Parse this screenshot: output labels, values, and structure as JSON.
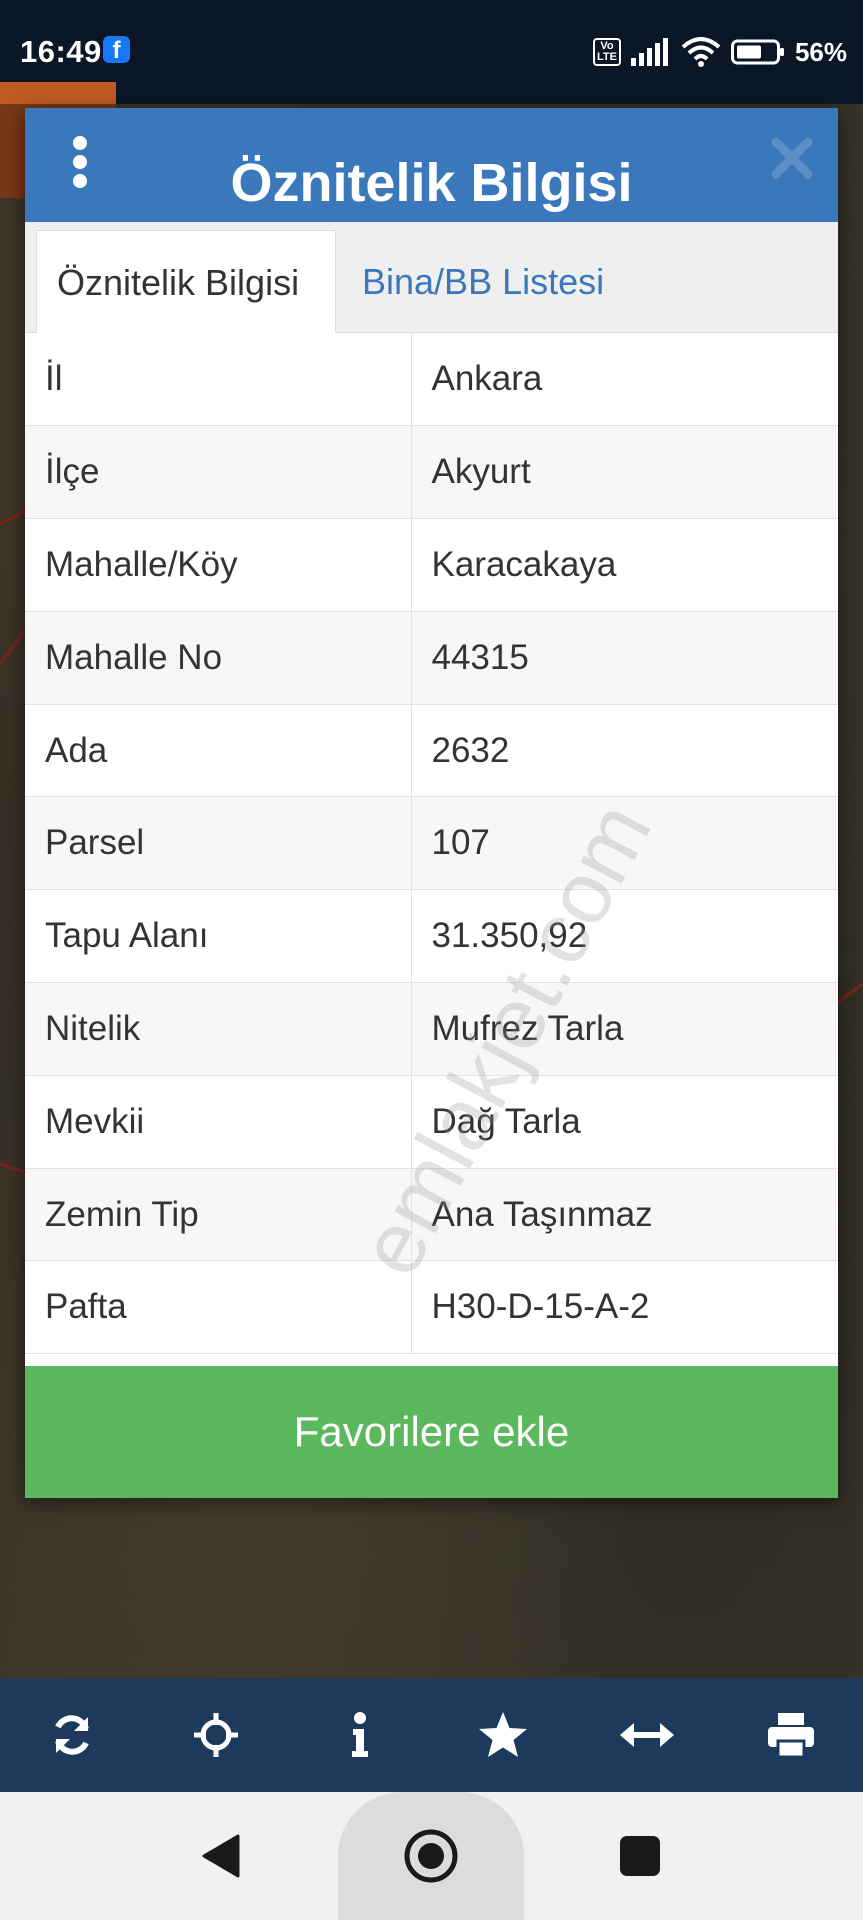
{
  "status": {
    "time": "16:49",
    "volte": "Vo\nLTE",
    "battery": "56%"
  },
  "dialog": {
    "title": "Öznitelik Bilgisi",
    "tabs": [
      {
        "label": "Öznitelik Bilgisi",
        "active": true
      },
      {
        "label": "Bina/BB Listesi",
        "active": false
      }
    ],
    "rows": [
      {
        "key": "İl",
        "value": "Ankara"
      },
      {
        "key": "İlçe",
        "value": "Akyurt"
      },
      {
        "key": "Mahalle/Köy",
        "value": "Karacakaya"
      },
      {
        "key": "Mahalle No",
        "value": "44315"
      },
      {
        "key": "Ada",
        "value": "2632"
      },
      {
        "key": "Parsel",
        "value": "107"
      },
      {
        "key": "Tapu Alanı",
        "value": "31.350,92"
      },
      {
        "key": "Nitelik",
        "value": "Mufrez Tarla"
      },
      {
        "key": "Mevkii",
        "value": "Dağ Tarla"
      },
      {
        "key": "Zemin Tip",
        "value": "Ana Taşınmaz"
      },
      {
        "key": "Pafta",
        "value": "H30-D-15-A-2"
      }
    ],
    "favorite_label": "Favorilere ekle"
  },
  "watermark": "emlakjet.com",
  "toolbar": {
    "items": [
      "refresh-icon",
      "locate-icon",
      "info-icon",
      "star-icon",
      "measure-icon",
      "print-icon"
    ]
  },
  "nav": {
    "items": [
      "back-icon",
      "home-icon",
      "recents-icon"
    ]
  },
  "colors": {
    "header": "#3a78bb",
    "favorite": "#5cb85c",
    "toolbar": "#1d3a5c",
    "tab_link": "#3a78bb"
  }
}
